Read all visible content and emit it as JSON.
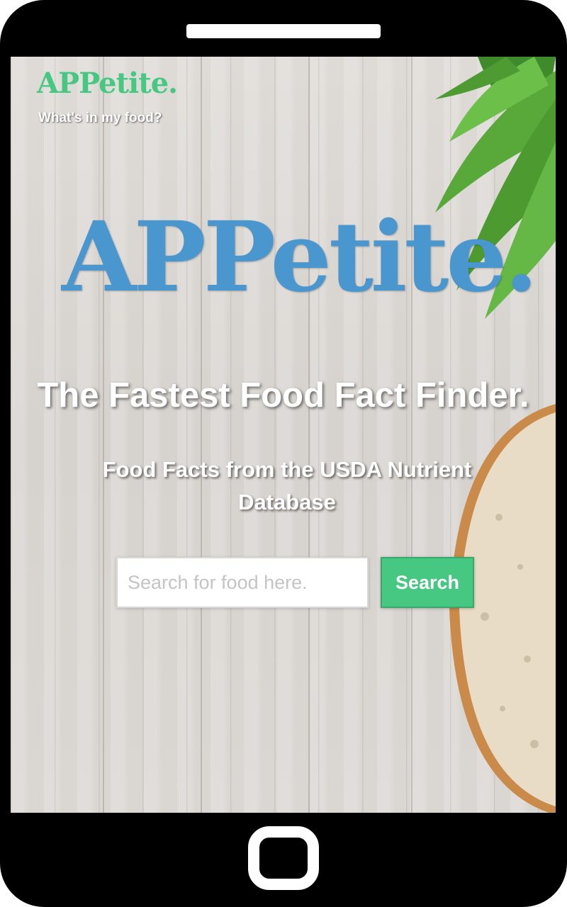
{
  "header": {
    "logo_text": "APPetite.",
    "tagline": "What's in my food?"
  },
  "hero": {
    "logo_text": "APPetite.",
    "headline": "The Fastest Food Fact Finder.",
    "subheadline": "Food Facts from the USDA Nutrient Database"
  },
  "search": {
    "placeholder": "Search for food here.",
    "value": "",
    "button_label": "Search"
  },
  "colors": {
    "brand_green": "#47c882",
    "brand_blue": "#4a96cf",
    "device_frame": "#000000"
  },
  "icons": {
    "home_button": "home-button-icon",
    "speaker": "speaker-icon"
  }
}
